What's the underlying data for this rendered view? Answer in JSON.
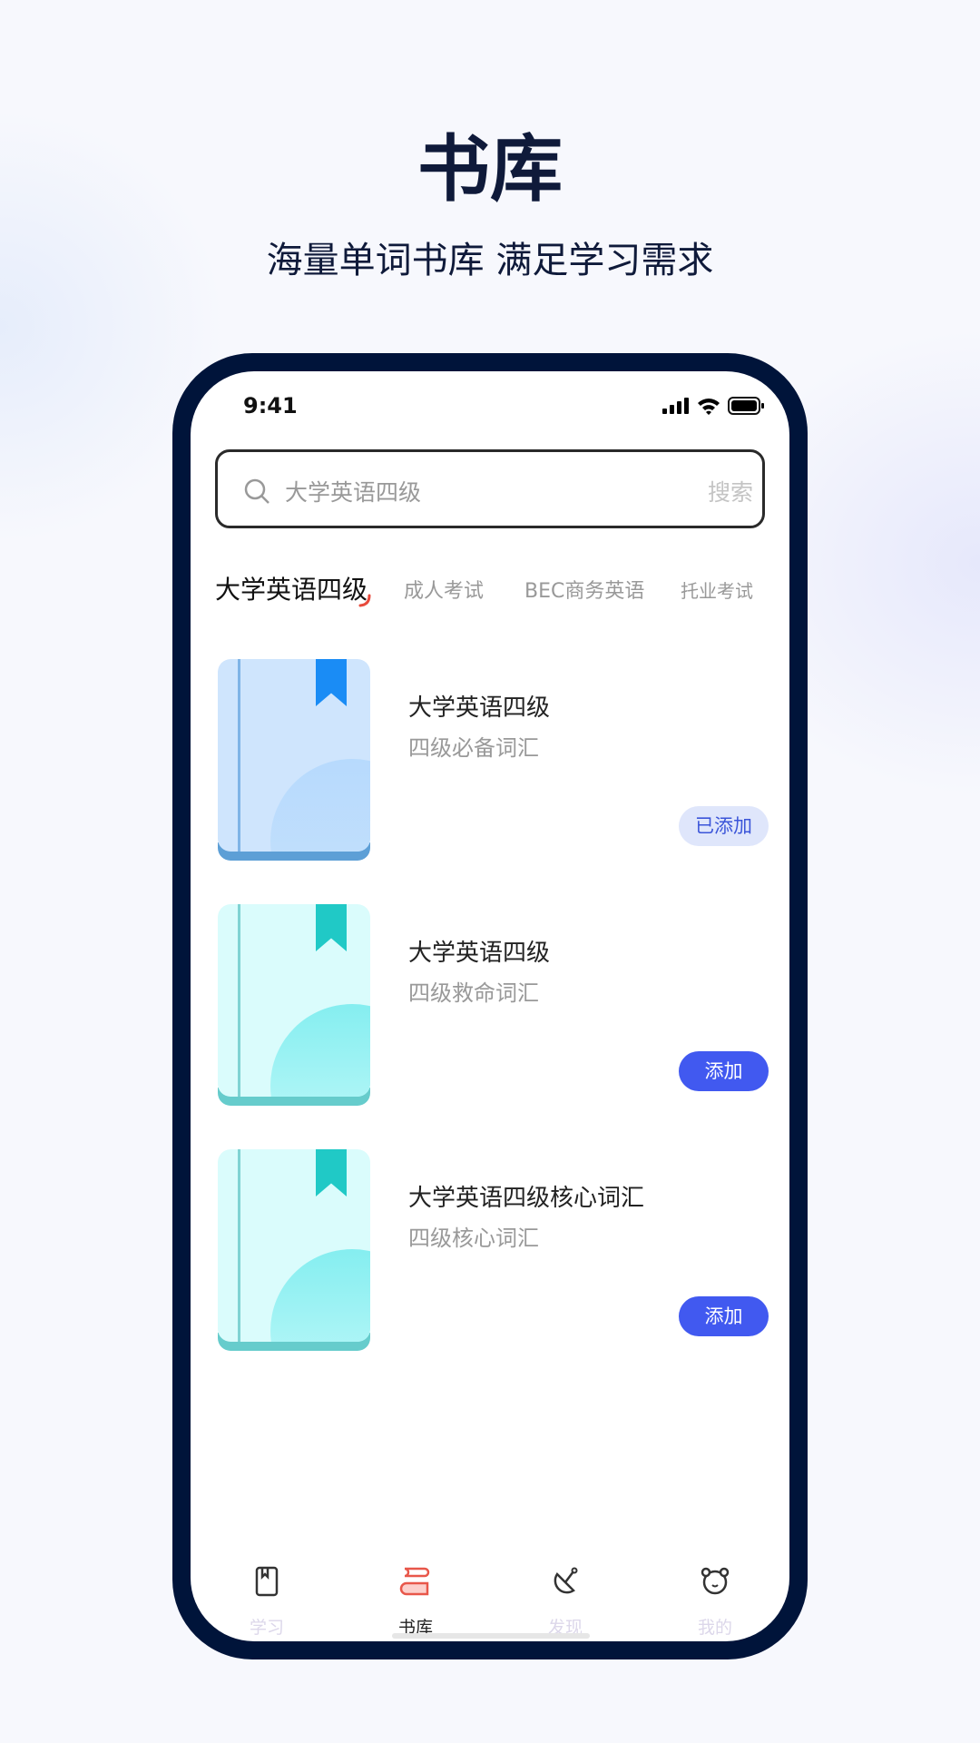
{
  "header": {
    "title": "书库",
    "subtitle": "海量单词书库 满足学习需求"
  },
  "status": {
    "time": "9:41"
  },
  "search": {
    "placeholder": "大学英语四级",
    "button": "搜索"
  },
  "tabs": [
    {
      "label": "大学英语四级",
      "active": true
    },
    {
      "label": "成人考试"
    },
    {
      "label": "BEC商务英语"
    },
    {
      "label": "托业考试"
    }
  ],
  "books": [
    {
      "title": "大学英语四级",
      "subtitle": "四级必备词汇",
      "action": "已添加",
      "added": true,
      "theme": "blue"
    },
    {
      "title": "大学英语四级",
      "subtitle": "四级救命词汇",
      "action": "添加",
      "added": false,
      "theme": "teal"
    },
    {
      "title": "大学英语四级核心词汇",
      "subtitle": "四级核心词汇",
      "action": "添加",
      "added": false,
      "theme": "teal"
    }
  ],
  "nav": [
    {
      "label": "学习",
      "icon": "book-icon"
    },
    {
      "label": "书库",
      "icon": "library-icon",
      "active": true
    },
    {
      "label": "发现",
      "icon": "satellite-dish-icon"
    },
    {
      "label": "我的",
      "icon": "bear-icon"
    }
  ],
  "colors": {
    "accent": "#4159f0",
    "active_tab_underline": "#e84a3c",
    "library_icon": "#e8574a",
    "frame": "#00143a"
  }
}
